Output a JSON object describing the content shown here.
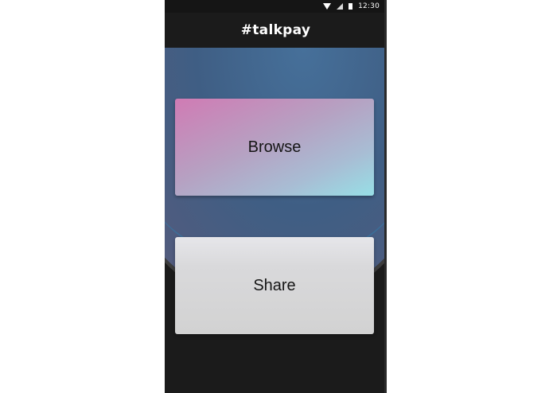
{
  "status_bar": {
    "time": "12:30",
    "icons": [
      "wifi-icon",
      "signal-icon",
      "battery-icon"
    ]
  },
  "app_bar": {
    "title": "#talkpay"
  },
  "actions": {
    "browse_label": "Browse",
    "share_label": "Share"
  },
  "colors": {
    "app_bar_background": "#1b1b1b",
    "status_bar_background": "#151515",
    "browse_gradient_start": "#d07bb4",
    "browse_gradient_end": "#97dfe6",
    "share_background": "#d2d2d2"
  }
}
